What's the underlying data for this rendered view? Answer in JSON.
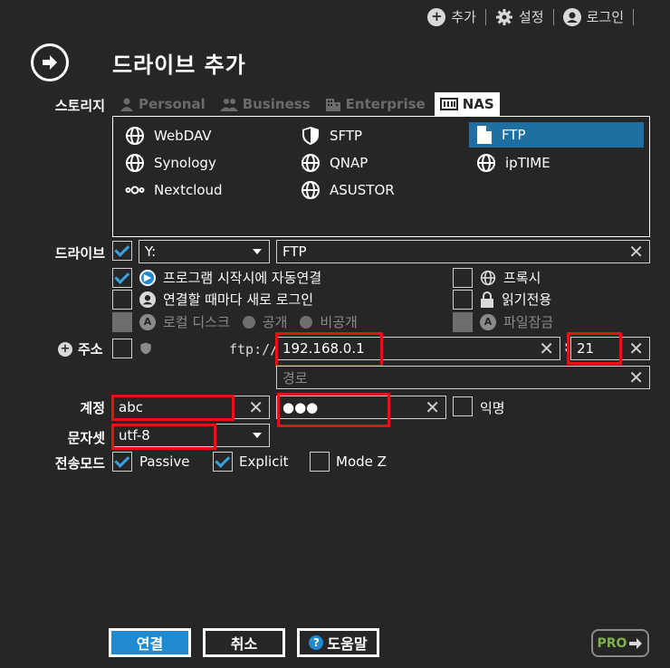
{
  "topbar": {
    "add": "추가",
    "settings": "설정",
    "login": "로그인"
  },
  "title": "드라이브 추가",
  "storage": {
    "label": "스토리지",
    "tabs": [
      "Personal",
      "Business",
      "Enterprise",
      "NAS"
    ]
  },
  "services": [
    "WebDAV",
    "SFTP",
    "FTP",
    "Synology",
    "QNAP",
    "ipTIME",
    "Nextcloud",
    "ASUSTOR"
  ],
  "drive": {
    "label": "드라이브",
    "letter": "Y:",
    "name": "FTP",
    "opt_autoconnect": "프로그램 시작시에 자동연결",
    "opt_relogin": "연결할 때마다 새로 로그인",
    "opt_localdisk": "로컬 디스크",
    "opt_public": "공개",
    "opt_private": "비공개",
    "opt_proxy": "프록시",
    "opt_readonly": "읽기전용",
    "opt_filelock": "파일잠금"
  },
  "address": {
    "label": "주소",
    "prefix": "ftp://",
    "host": "192.168.0.1",
    "port": "21",
    "path_placeholder": "경로"
  },
  "account": {
    "label": "계정",
    "user": "abc",
    "password": "●●●",
    "anonymous": "익명"
  },
  "charset": {
    "label": "문자셋",
    "value": "utf-8"
  },
  "transfer": {
    "label": "전송모드",
    "passive": "Passive",
    "explicit": "Explicit",
    "modez": "Mode Z"
  },
  "buttons": {
    "connect": "연결",
    "cancel": "취소",
    "help": "도움말",
    "pro": "PRO"
  },
  "colors": {
    "bg": "#262626",
    "accent": "#1f6fa3",
    "highlight": "#e01414",
    "pro": "#7fb04a"
  }
}
